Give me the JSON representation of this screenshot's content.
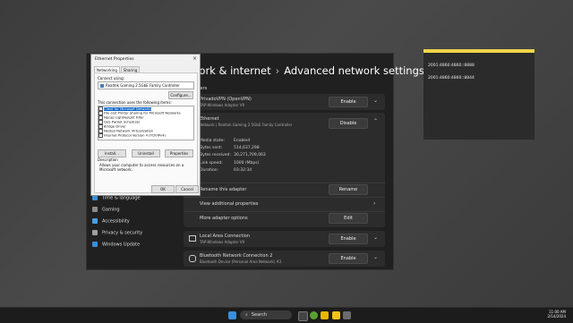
{
  "settings": {
    "breadcrumb_parent": "work & internet",
    "breadcrumb_sep": "›",
    "title": "Advanced network settings",
    "section": "adapters",
    "adapters": [
      {
        "name": "PrivadoVPN (OpenVPN)",
        "desc": "TAP-Windows Adapter V9",
        "action": "Enable"
      },
      {
        "name": "Ethernet",
        "desc": "Network | Realtek Gaming 2.5GbE Family Controller",
        "action": "Disable"
      },
      {
        "name": "Local Area Connection",
        "desc": "TAP-Windows Adapter V9",
        "action": "Enable"
      },
      {
        "name": "Bluetooth Network Connection 2",
        "desc": "Bluetooth Device (Personal Area Network) #2",
        "action": "Enable"
      }
    ],
    "ethernet_details": [
      {
        "label": "Media state:",
        "value": "Enabled"
      },
      {
        "label": "Bytes sent:",
        "value": "514,637,298"
      },
      {
        "label": "Bytes received:",
        "value": "30,271,709,063"
      },
      {
        "label": "Link speed:",
        "value": "1000 (Mbps)"
      },
      {
        "label": "Duration:",
        "value": "03:32:34"
      }
    ],
    "rename_label": "Rename this adapter",
    "rename_button": "Rename",
    "view_props": "View additional properties",
    "more_options": "More adapter options",
    "edit_button": "Edit",
    "nav": [
      {
        "label": "Time & language",
        "color": "#3a8fd9"
      },
      {
        "label": "Gaming",
        "color": "#8a8a8a"
      },
      {
        "label": "Accessibility",
        "color": "#4aa0e0"
      },
      {
        "label": "Privacy & security",
        "color": "#9aa0a6"
      },
      {
        "label": "Windows Update",
        "color": "#3a8fd9"
      }
    ]
  },
  "dialog": {
    "title": "Ethernet Properties",
    "tabs": [
      "Networking",
      "Sharing"
    ],
    "connect_using": "Connect using:",
    "adapter": "Realtek Gaming 2.5GbE Family Controller",
    "configure": "Configure...",
    "items_label": "This connection uses the following items:",
    "items": [
      {
        "label": "Client for Microsoft Networks",
        "checked": true,
        "selected": true
      },
      {
        "label": "File and Printer Sharing for Microsoft Networks",
        "checked": true
      },
      {
        "label": "Npcap Lightweight Filter",
        "checked": true
      },
      {
        "label": "QoS Packet Scheduler",
        "checked": true
      },
      {
        "label": "Bridge Driver",
        "checked": true
      },
      {
        "label": "Nested Network Virtualization",
        "checked": true
      },
      {
        "label": "Internet Protocol Version 4 (TCP/IPv4)",
        "checked": true
      }
    ],
    "install": "Install...",
    "uninstall": "Uninstall",
    "properties": "Properties",
    "description_label": "Description",
    "description": "Allows your computer to access resources on a Microsoft network.",
    "ok": "OK",
    "cancel": "Cancel"
  },
  "note": {
    "lines": [
      "2001:4860:4860::8888",
      "2001:4860:4860::8844"
    ]
  },
  "taskbar": {
    "search": "Search",
    "time": "11:00 AM",
    "date": "2/14/2024"
  }
}
